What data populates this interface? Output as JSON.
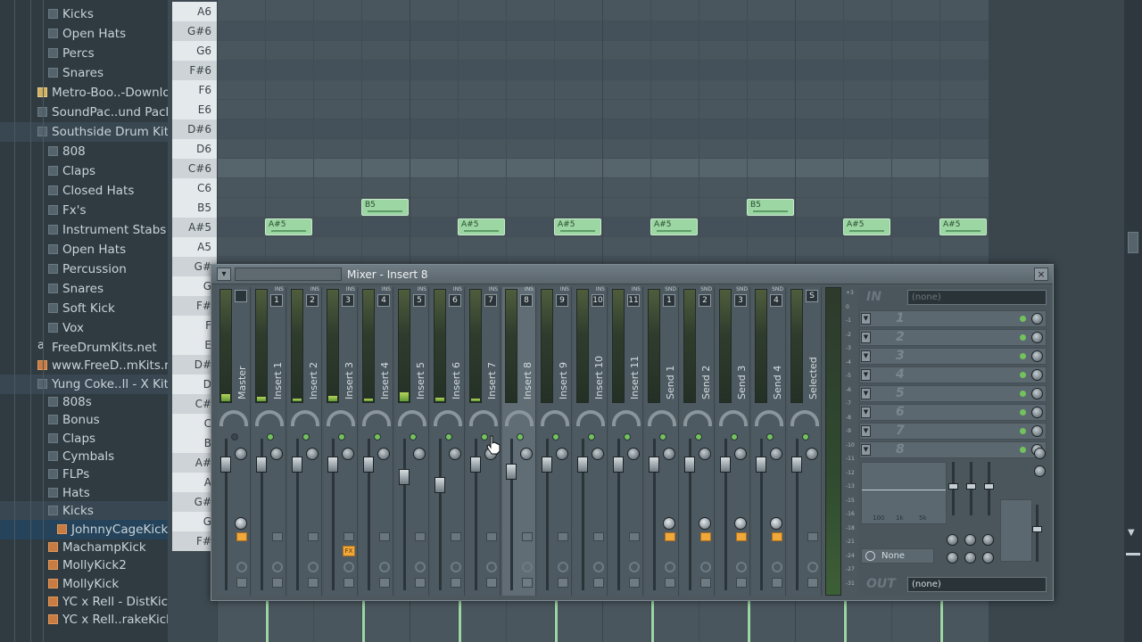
{
  "browser": {
    "items": [
      {
        "label": "Kicks",
        "type": "folder",
        "indent": 2
      },
      {
        "label": "Open Hats",
        "type": "folder",
        "indent": 2
      },
      {
        "label": "Percs",
        "type": "folder",
        "indent": 2
      },
      {
        "label": "Snares",
        "type": "folder",
        "indent": 2
      },
      {
        "label": "Metro-Boo..-Download",
        "type": "clip",
        "indent": 1
      },
      {
        "label": "SoundPac..und Pack",
        "type": "folder",
        "indent": 1
      },
      {
        "label": "Southside Drum Kit",
        "type": "folder",
        "indent": 1,
        "state": "hl"
      },
      {
        "label": "808",
        "type": "folder",
        "indent": 2
      },
      {
        "label": "Claps",
        "type": "folder",
        "indent": 2
      },
      {
        "label": "Closed Hats",
        "type": "folder",
        "indent": 2
      },
      {
        "label": "Fx's",
        "type": "folder",
        "indent": 2
      },
      {
        "label": "Instrument Stabs",
        "type": "folder",
        "indent": 2
      },
      {
        "label": "Open Hats",
        "type": "folder",
        "indent": 2
      },
      {
        "label": "Percussion",
        "type": "folder",
        "indent": 2
      },
      {
        "label": "Snares",
        "type": "folder",
        "indent": 2
      },
      {
        "label": "Soft Kick",
        "type": "folder",
        "indent": 2
      },
      {
        "label": "Vox",
        "type": "folder",
        "indent": 2
      },
      {
        "label": "FreeDrumKits.net",
        "type": "text",
        "indent": 1
      },
      {
        "label": "www.FreeD..mKits.net",
        "type": "file",
        "indent": 1
      },
      {
        "label": "Yung Coke..ll - X Kit",
        "type": "folder",
        "indent": 1,
        "state": "hl"
      },
      {
        "label": "808s",
        "type": "folder",
        "indent": 2
      },
      {
        "label": "Bonus",
        "type": "folder",
        "indent": 2
      },
      {
        "label": "Claps",
        "type": "folder",
        "indent": 2
      },
      {
        "label": "Cymbals",
        "type": "folder",
        "indent": 2
      },
      {
        "label": "FLPs",
        "type": "folder",
        "indent": 2
      },
      {
        "label": "Hats",
        "type": "folder",
        "indent": 2
      },
      {
        "label": "Kicks",
        "type": "folder",
        "indent": 2,
        "state": "hl"
      },
      {
        "label": "JohnnyCageKick",
        "type": "file",
        "indent": 3,
        "state": "sel"
      },
      {
        "label": "MachampKick",
        "type": "file",
        "indent": 2
      },
      {
        "label": "MollyKick2",
        "type": "file",
        "indent": 2
      },
      {
        "label": "MollyKick",
        "type": "file",
        "indent": 2
      },
      {
        "label": "YC x Rell - DistKick",
        "type": "file",
        "indent": 2
      },
      {
        "label": "YC x Rell..rakeKick",
        "type": "file",
        "indent": 2
      }
    ]
  },
  "pianoroll": {
    "keys": [
      {
        "label": "A6",
        "type": "white"
      },
      {
        "label": "G#6",
        "type": "black"
      },
      {
        "label": "G6",
        "type": "white"
      },
      {
        "label": "F#6",
        "type": "black"
      },
      {
        "label": "F6",
        "type": "white"
      },
      {
        "label": "E6",
        "type": "white"
      },
      {
        "label": "D#6",
        "type": "black"
      },
      {
        "label": "D6",
        "type": "white"
      },
      {
        "label": "C#6",
        "type": "black"
      },
      {
        "label": "C6",
        "type": "white"
      },
      {
        "label": "B5",
        "type": "white"
      },
      {
        "label": "A#5",
        "type": "black"
      },
      {
        "label": "A5",
        "type": "white"
      },
      {
        "label": "G#5",
        "type": "black"
      },
      {
        "label": "G5",
        "type": "white"
      },
      {
        "label": "F#5",
        "type": "black"
      },
      {
        "label": "F5",
        "type": "white"
      },
      {
        "label": "E5",
        "type": "white"
      },
      {
        "label": "D#5",
        "type": "black"
      },
      {
        "label": "D5",
        "type": "white"
      },
      {
        "label": "C#5",
        "type": "black"
      },
      {
        "label": "C5",
        "type": "white"
      },
      {
        "label": "B4",
        "type": "white"
      },
      {
        "label": "A#4",
        "type": "black"
      },
      {
        "label": "A4",
        "type": "white"
      },
      {
        "label": "G#4",
        "type": "black"
      },
      {
        "label": "G4",
        "type": "white"
      },
      {
        "label": "F#4",
        "type": "black"
      }
    ],
    "key_labels_shown": [
      "A6",
      "G#6",
      "G6",
      "F#6",
      "F6",
      "E6",
      "D#6",
      "D6",
      "C#6",
      "C6",
      "B5",
      "A#5",
      "A5",
      "G#",
      "G",
      "F#",
      "F",
      "E",
      "D#",
      "D",
      "C#",
      "C",
      "B",
      "A#",
      "A",
      "G#",
      "G",
      "F#"
    ],
    "notes": [
      {
        "label": "A#5",
        "beat": 1
      },
      {
        "label": "B5",
        "beat": 3
      },
      {
        "label": "A#5",
        "beat": 5
      },
      {
        "label": "A#5",
        "beat": 7
      },
      {
        "label": "A#5",
        "beat": 9
      },
      {
        "label": "B5",
        "beat": 11
      },
      {
        "label": "A#5",
        "beat": 13
      },
      {
        "label": "A#5",
        "beat": 15
      }
    ]
  },
  "mixer": {
    "title": "Mixer - Insert 8",
    "close_icon": "×",
    "strips": [
      {
        "name": "Master",
        "slot": "",
        "slot_type": "",
        "level": 0.06,
        "fader": 0.5,
        "dot": false,
        "route": false,
        "fx": false
      },
      {
        "name": "Insert 1",
        "slot": "1",
        "slot_type": "INS",
        "level": 0.04,
        "fader": 0.5,
        "dot": true,
        "route": false,
        "fx": false
      },
      {
        "name": "Insert 2",
        "slot": "2",
        "slot_type": "INS",
        "level": 0.02,
        "fader": 0.5,
        "dot": true,
        "route": false,
        "fx": false
      },
      {
        "name": "Insert 3",
        "slot": "3",
        "slot_type": "INS",
        "level": 0.05,
        "fader": 0.5,
        "dot": true,
        "route": false,
        "fx": true
      },
      {
        "name": "Insert 4",
        "slot": "4",
        "slot_type": "INS",
        "level": 0.02,
        "fader": 0.5,
        "dot": true,
        "route": false,
        "fx": false
      },
      {
        "name": "Insert 5",
        "slot": "5",
        "slot_type": "INS",
        "level": 0.08,
        "fader": 0.38,
        "dot": true,
        "route": false,
        "fx": false
      },
      {
        "name": "Insert 6",
        "slot": "6",
        "slot_type": "INS",
        "level": 0.03,
        "fader": 0.31,
        "dot": true,
        "route": false,
        "fx": false
      },
      {
        "name": "Insert 7",
        "slot": "7",
        "slot_type": "INS",
        "level": 0.02,
        "fader": 0.5,
        "dot": true,
        "route": false,
        "fx": false
      },
      {
        "name": "Insert 8",
        "slot": "8",
        "slot_type": "INS",
        "level": 0.0,
        "fader": 0.43,
        "dot": true,
        "route": false,
        "fx": false,
        "selected": true
      },
      {
        "name": "Insert 9",
        "slot": "9",
        "slot_type": "INS",
        "level": 0.0,
        "fader": 0.5,
        "dot": true,
        "route": false,
        "fx": false
      },
      {
        "name": "Insert 10",
        "slot": "10",
        "slot_type": "INS",
        "level": 0.0,
        "fader": 0.5,
        "dot": true,
        "route": false,
        "fx": false
      },
      {
        "name": "Insert 11",
        "slot": "11",
        "slot_type": "INS",
        "level": 0.0,
        "fader": 0.5,
        "dot": true,
        "route": false,
        "fx": false
      },
      {
        "name": "Send 1",
        "slot": "1",
        "slot_type": "SND",
        "level": 0.0,
        "fader": 0.5,
        "dot": true,
        "route": true,
        "fx": false
      },
      {
        "name": "Send 2",
        "slot": "2",
        "slot_type": "SND",
        "level": 0.0,
        "fader": 0.5,
        "dot": true,
        "route": true,
        "fx": false
      },
      {
        "name": "Send 3",
        "slot": "3",
        "slot_type": "SND",
        "level": 0.0,
        "fader": 0.5,
        "dot": true,
        "route": true,
        "fx": false
      },
      {
        "name": "Send 4",
        "slot": "4",
        "slot_type": "SND",
        "level": 0.0,
        "fader": 0.5,
        "dot": true,
        "route": true,
        "fx": false
      },
      {
        "name": "Selected",
        "slot": "S",
        "slot_type": "",
        "level": 0.0,
        "fader": 0.5,
        "dot": true,
        "route": false,
        "fx": false
      }
    ],
    "fx_label": "FX",
    "scale": [
      "+3",
      "0",
      "-1",
      "-2",
      "-3",
      "-4",
      "-5",
      "-6",
      "-7",
      "-8",
      "-9",
      "-10",
      "-11",
      "-12",
      "-13",
      "-15",
      "-16",
      "-18",
      "-21",
      "-24",
      "-27",
      "-31"
    ],
    "in_label": "IN",
    "in_value": "(none)",
    "out_label": "OUT",
    "out_value": "(none)",
    "effect_slots": [
      "1",
      "2",
      "3",
      "4",
      "5",
      "6",
      "7",
      "8"
    ],
    "eq_freqs": [
      "100",
      "1k",
      "5k"
    ],
    "track_sel": "None"
  }
}
